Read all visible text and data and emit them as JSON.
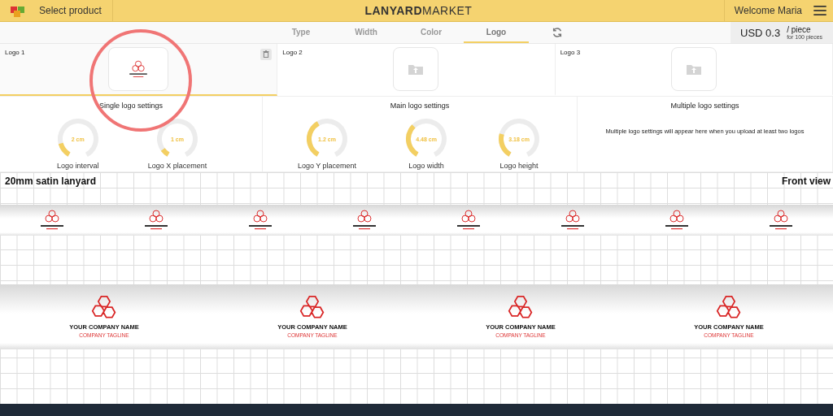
{
  "header": {
    "product_link": "Select product",
    "brand": "**LANYARD**MARKET",
    "welcome": "Welcome Maria"
  },
  "tabs": [
    {
      "label": "Type",
      "selected": false
    },
    {
      "label": "Width",
      "selected": false
    },
    {
      "label": "Color",
      "selected": false
    },
    {
      "label": "Logo",
      "selected": true
    }
  ],
  "price": {
    "amount": "USD 0.3",
    "unit": "/ piece",
    "note": "for 100 pieces"
  },
  "logo_slots": [
    {
      "label": "Logo 1",
      "kind": "uploaded",
      "selected": true
    },
    {
      "label": "Logo 2",
      "kind": "empty",
      "selected": false
    },
    {
      "label": "Logo 3",
      "kind": "empty",
      "selected": false
    }
  ],
  "settings": [
    {
      "title": "Single logo settings",
      "dials": [
        {
          "label": "Logo interval",
          "reading": "2 cm",
          "level": 0.15
        },
        {
          "label": "Logo X placement",
          "reading": "1 cm",
          "level": 0.08
        }
      ]
    },
    {
      "title": "Main logo settings",
      "dials": [
        {
          "label": "Logo Y placement",
          "reading": "1.2 cm",
          "level": 0.4
        },
        {
          "label": "Logo width",
          "reading": "4.48 cm",
          "level": 0.35
        },
        {
          "label": "Logo height",
          "reading": "3.18 cm",
          "level": 0.25
        }
      ]
    },
    {
      "title": "Multiple logo settings",
      "note": "Multiple logo settings will appear here when you upload at least two logos"
    }
  ],
  "preview": {
    "title": "20mm satin lanyard",
    "view": "Front view",
    "large_logos": [
      {
        "name": "YOUR COMPANY NAME",
        "tagline": "COMPANY TAGLINE"
      },
      {
        "name": "YOUR COMPANY NAME",
        "tagline": "COMPANY TAGLINE"
      },
      {
        "name": "YOUR COMPANY NAME",
        "tagline": "COMPANY TAGLINE"
      },
      {
        "name": "YOUR COMPANY NAME",
        "tagline": "COMPANY TAGLINE"
      }
    ]
  }
}
